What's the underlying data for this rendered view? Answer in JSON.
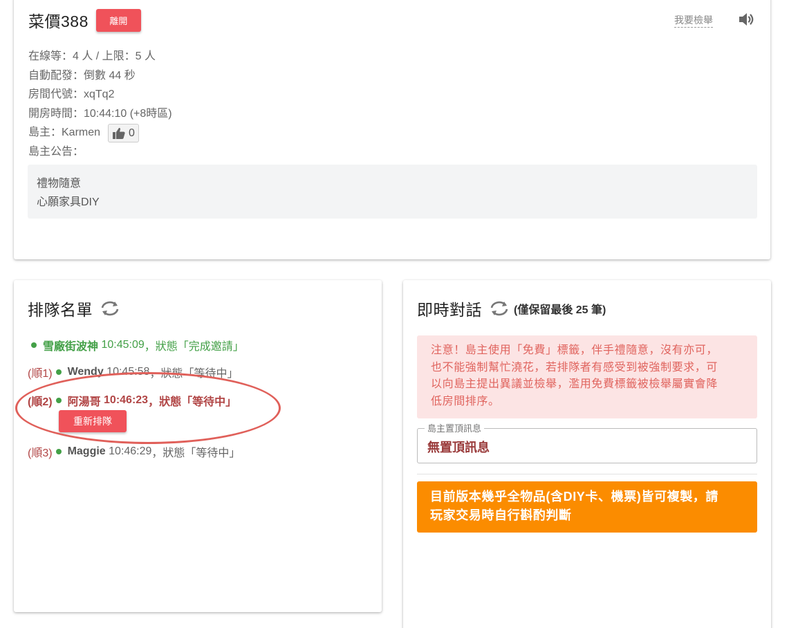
{
  "room": {
    "title": "菜價388",
    "leave_label": "離開",
    "report_label": "我要檢舉",
    "online_text": "在線等：4 人 / 上限：5 人",
    "auto_dispatch_text": "自動配發：倒數 44 秒",
    "room_code_text": "房間代號：xqTq2",
    "open_time_text": "開房時間：10:44:10 (+8時區)",
    "host_text": "島主：Karmen",
    "like_count": "0",
    "announcement_label": "島主公告：",
    "announcement_lines": [
      "禮物隨意",
      "心願家具DIY"
    ]
  },
  "queue": {
    "title": "排隊名單",
    "items": [
      {
        "order": "",
        "name": "雪廠街波神",
        "time": "10:45:09",
        "status": "，狀態「完成邀請」"
      },
      {
        "order": "(順1)",
        "name": "Wendy",
        "time": "10:45:58",
        "status": "，狀態「等待中」"
      },
      {
        "order": "(順2)",
        "name": "阿湯哥",
        "time": "10:46:23",
        "status": "，狀態「等待中」"
      },
      {
        "order": "(順3)",
        "name": "Maggie",
        "time": "10:46:29",
        "status": "，狀態「等待中」"
      }
    ],
    "requeue_label": "重新排隊"
  },
  "chat": {
    "title": "即時對話",
    "retain_note": "(僅保留最後 25 筆)",
    "warning_lines": [
      "注意！島主使用「免費」標籤，伴手禮隨意，沒有亦可，",
      "也不能強制幫忙澆花，若排隊者有感受到被強制要求，可",
      "以向島主提出異議並檢舉，濫用免費標籤被檢舉屬實會降",
      "低房間排序。"
    ],
    "pinned_label": "島主置頂訊息",
    "pinned_value": "無置頂訊息",
    "notice_lines": [
      "目前版本幾乎全物品(含DIY卡、機票)皆可複製，請",
      "玩家交易時自行斟酌判斷"
    ]
  },
  "colors": {
    "accent_red": "#f0525a",
    "online_green": "#43a047",
    "warning_bg": "#fce4e4",
    "notice_orange": "#fb8c00"
  },
  "icons": {
    "sound": "speaker-icon",
    "like": "thumbs-up-icon",
    "refresh": "refresh-icon"
  }
}
